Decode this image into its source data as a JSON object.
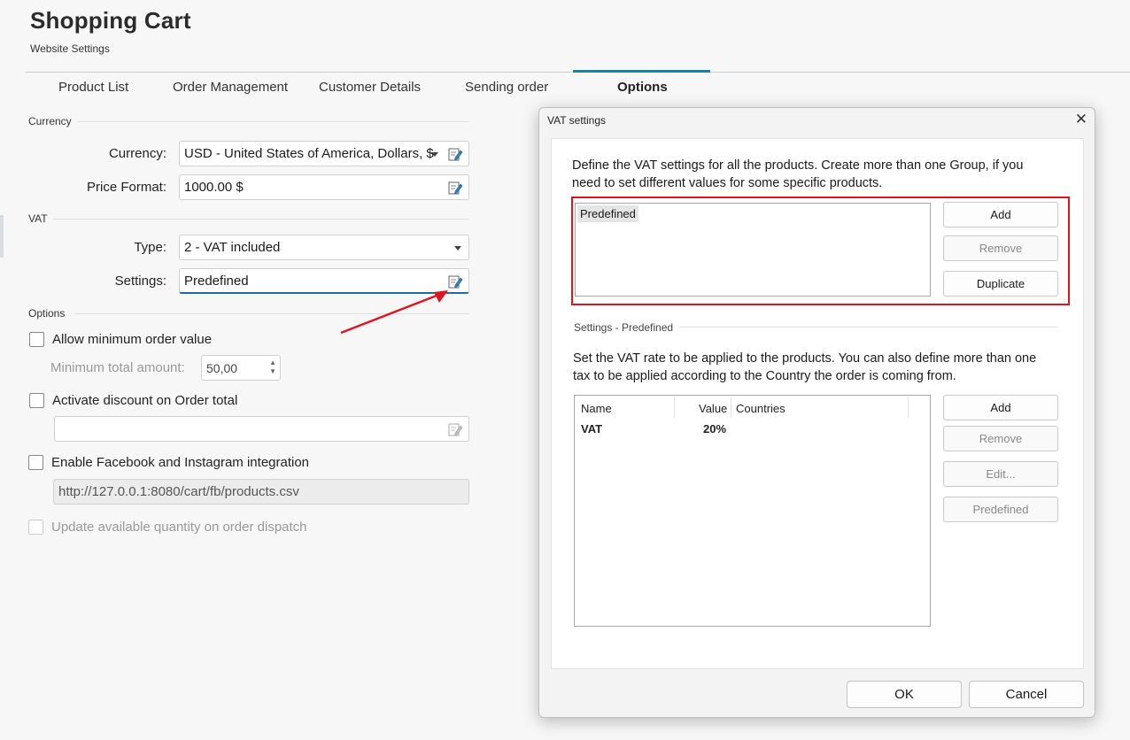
{
  "header": {
    "title": "Shopping Cart",
    "subtitle": "Website Settings"
  },
  "tabs": [
    {
      "label": "Product List"
    },
    {
      "label": "Order Management"
    },
    {
      "label": "Customer Details"
    },
    {
      "label": "Sending order"
    },
    {
      "label": "Options"
    }
  ],
  "active_tab": "Options",
  "currency_section": {
    "label": "Currency",
    "currency_label": "Currency:",
    "currency_value": "USD - United States of America, Dollars, $",
    "price_format_label": "Price Format:",
    "price_format_value": "1000.00 $"
  },
  "vat_section": {
    "label": "VAT",
    "type_label": "Type:",
    "type_value": "2 - VAT included",
    "settings_label": "Settings:",
    "settings_value": "Predefined"
  },
  "options_section": {
    "label": "Options",
    "allow_min_order": "Allow minimum order value",
    "min_total_label": "Minimum total amount:",
    "min_total_value": "50,00",
    "activate_discount": "Activate discount on Order total",
    "discount_value": "",
    "enable_facebook": "Enable Facebook and Instagram integration",
    "facebook_url": "http://127.0.0.1:8080/cart/fb/products.csv",
    "update_quantity": "Update available quantity on order dispatch"
  },
  "vat_dialog": {
    "title": "VAT settings",
    "close": "✕",
    "intro_line1": "Define the VAT settings for all the products. Create more than one Group, if you",
    "intro_line2": "need to set different values for some specific products.",
    "groups": [
      "Predefined"
    ],
    "group_buttons": {
      "add": "Add",
      "remove": "Remove",
      "duplicate": "Duplicate"
    },
    "settings_label": "Settings - Predefined",
    "rate_line1": "Set the VAT rate to be applied to the products. You can also define more than one",
    "rate_line2": "tax to be applied according to the Country the order is coming from.",
    "table": {
      "headers": [
        "Name",
        "Value",
        "Countries"
      ],
      "rows": [
        {
          "name": "VAT",
          "value": "20%",
          "countries": ""
        }
      ]
    },
    "rate_buttons": {
      "add": "Add",
      "remove": "Remove",
      "edit": "Edit...",
      "predefined": "Predefined"
    },
    "ok": "OK",
    "cancel": "Cancel"
  },
  "colors": {
    "accent": "#1e7fa5",
    "highlight_red": "#e0141e"
  }
}
